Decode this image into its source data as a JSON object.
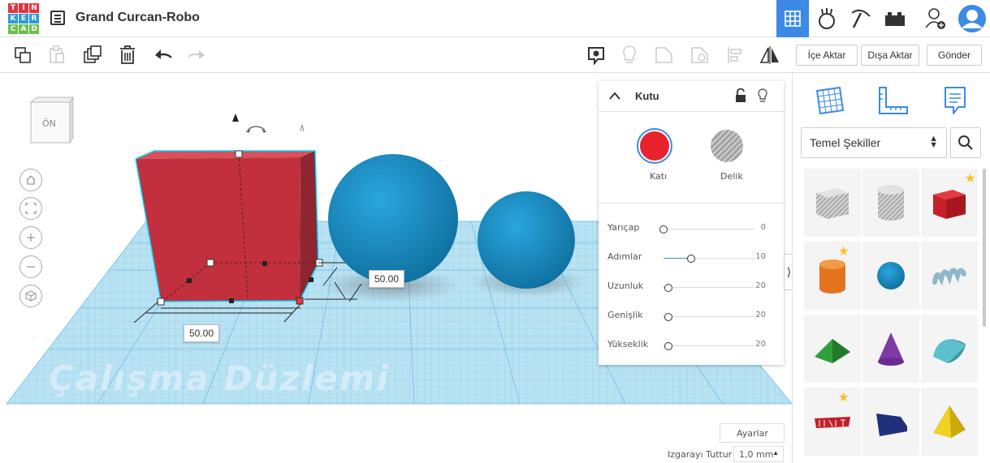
{
  "logo": {
    "letters": [
      "T",
      "I",
      "N",
      "K",
      "E",
      "R",
      "C",
      "A",
      "D"
    ],
    "colors": [
      "#e8323e",
      "#e8323e",
      "#e8323e",
      "#2c9bd6",
      "#2c9bd6",
      "#2c9bd6",
      "#6cc04a",
      "#6cc04a",
      "#6cc04a"
    ]
  },
  "header": {
    "title": "Grand Curcan-Robo",
    "buttons": [
      "grid-view-icon",
      "tinkercad-hand-icon",
      "blocks-icon",
      "bricks-icon",
      "add-user-icon",
      "user-avatar"
    ]
  },
  "toolbar": {
    "import_label": "İçe Aktar",
    "export_label": "Dışa Aktar",
    "send_label": "Gönder"
  },
  "viewport": {
    "view_cube_label": "ÖN",
    "watermark": "Çalışma Düzlemi",
    "dim_width": "50.00",
    "dim_depth": "50.00",
    "settings_label": "Ayarlar",
    "snap_label": "Izgarayı Tuttur",
    "snap_value": "1,0 mm"
  },
  "inspector": {
    "title": "Kutu",
    "solid_label": "Katı",
    "hole_label": "Delik",
    "solid_color": "#e8222c",
    "params": [
      {
        "name": "Yarıçap",
        "value": "0",
        "position": 0
      },
      {
        "name": "Adımlar",
        "value": "10",
        "position": 0.3
      },
      {
        "name": "Uzunluk",
        "value": "20",
        "position": 0.05
      },
      {
        "name": "Genişlik",
        "value": "20",
        "position": 0.05
      },
      {
        "name": "Yükseklik",
        "value": "20",
        "position": 0.05
      }
    ]
  },
  "right_panel": {
    "category": "Temel Şekiller",
    "shapes": [
      "box-hole",
      "cylinder-hole",
      "box",
      "cylinder",
      "sphere",
      "scribble",
      "roof",
      "cone",
      "round-roof",
      "text",
      "wedge",
      "pyramid"
    ]
  },
  "colors": {
    "accent": "#3c8ae5",
    "shape_blue": "#1c8fc7",
    "box_red": "#c1303c",
    "grid": "#9fd3ec"
  }
}
